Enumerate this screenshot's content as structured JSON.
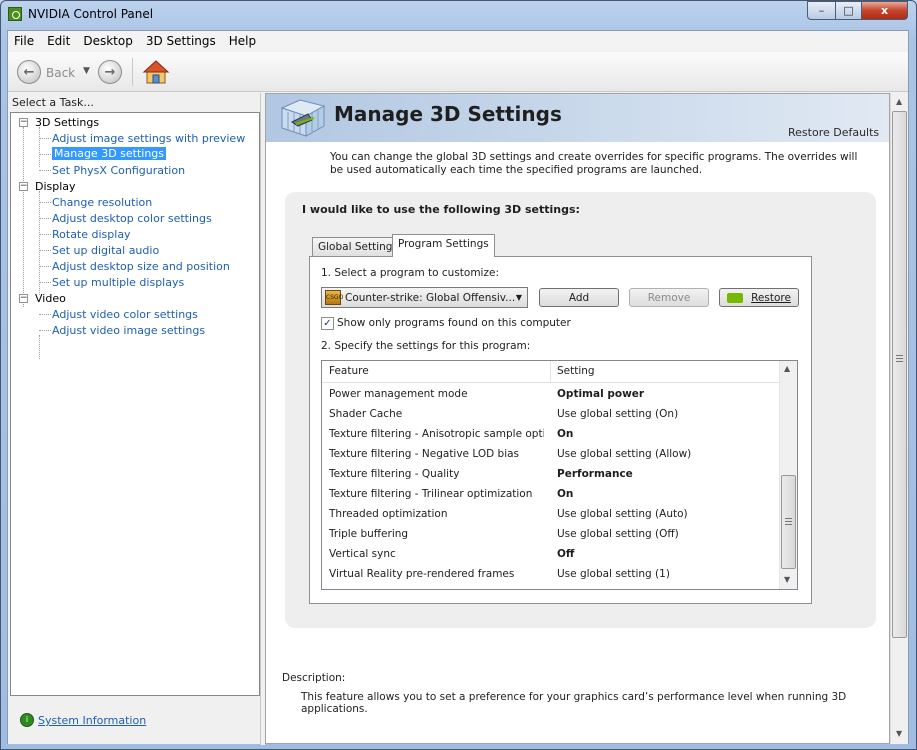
{
  "window": {
    "title": "NVIDIA Control Panel",
    "minimize": "–",
    "maximize": "□",
    "close": "x"
  },
  "menu": [
    "File",
    "Edit",
    "Desktop",
    "3D Settings",
    "Help"
  ],
  "toolbar": {
    "back_label": "Back",
    "back_dropdown": "▼",
    "back_arrow": "←",
    "forward_arrow": "→"
  },
  "task_pane": {
    "header": "Select a Task...",
    "tree": [
      {
        "label": "3D Settings",
        "type": "category",
        "expanded": "−"
      },
      {
        "label": "Adjust image settings with preview",
        "type": "link"
      },
      {
        "label": "Manage 3D settings",
        "type": "link",
        "selected": true
      },
      {
        "label": "Set PhysX Configuration",
        "type": "link"
      },
      {
        "label": "Display",
        "type": "category",
        "expanded": "−"
      },
      {
        "label": "Change resolution",
        "type": "link"
      },
      {
        "label": "Adjust desktop color settings",
        "type": "link"
      },
      {
        "label": "Rotate display",
        "type": "link"
      },
      {
        "label": "Set up digital audio",
        "type": "link"
      },
      {
        "label": "Adjust desktop size and position",
        "type": "link"
      },
      {
        "label": "Set up multiple displays",
        "type": "link"
      },
      {
        "label": "Video",
        "type": "category",
        "expanded": "−"
      },
      {
        "label": "Adjust video color settings",
        "type": "link"
      },
      {
        "label": "Adjust video image settings",
        "type": "link"
      }
    ],
    "system_info": "System Information",
    "system_info_icon": "i"
  },
  "page": {
    "title": "Manage 3D Settings",
    "restore_defaults": "Restore Defaults",
    "intro": "You can change the global 3D settings and create overrides for specific programs. The overrides will be used automatically each time the specified programs are launched.",
    "settings_heading": "I would like to use the following 3D settings:",
    "tabs": {
      "global": "Global Settings",
      "program": "Program Settings"
    },
    "select_label": "1. Select a program to customize:",
    "program_value": "Counter-strike: Global Offensiv...",
    "program_icon_text": "CSGO",
    "select_arrow": "▼",
    "add_button": "Add",
    "remove_button": "Remove",
    "restore_button": "Restore",
    "checkbox_mark": "✓",
    "checkbox_checked": true,
    "checkbox_label": "Show only programs found on this computer",
    "specify_label": "2. Specify the settings for this program:",
    "table_headers": {
      "feature": "Feature",
      "setting": "Setting"
    },
    "table_rows": [
      {
        "feature": "Power management mode",
        "setting": "Optimal power",
        "bold": true
      },
      {
        "feature": "Shader Cache",
        "setting": "Use global setting (On)",
        "bold": false
      },
      {
        "feature": "Texture filtering - Anisotropic sample opti...",
        "setting": "On",
        "bold": true
      },
      {
        "feature": "Texture filtering - Negative LOD bias",
        "setting": "Use global setting (Allow)",
        "bold": false
      },
      {
        "feature": "Texture filtering - Quality",
        "setting": "Performance",
        "bold": true
      },
      {
        "feature": "Texture filtering - Trilinear optimization",
        "setting": "On",
        "bold": true
      },
      {
        "feature": "Threaded optimization",
        "setting": "Use global setting (Auto)",
        "bold": false
      },
      {
        "feature": "Triple buffering",
        "setting": "Use global setting (Off)",
        "bold": false
      },
      {
        "feature": "Vertical sync",
        "setting": "Off",
        "bold": true
      },
      {
        "feature": "Virtual Reality pre-rendered frames",
        "setting": "Use global setting (1)",
        "bold": false
      }
    ],
    "scroll_up": "▲",
    "scroll_down": "▼",
    "description_label": "Description:",
    "description_text": "This feature allows you to set a preference for your graphics card’s performance level when running 3D applications."
  },
  "colors": {
    "link": "#1d5fb2",
    "selection": "#3399ff",
    "nvidia_green": "#76b900"
  }
}
